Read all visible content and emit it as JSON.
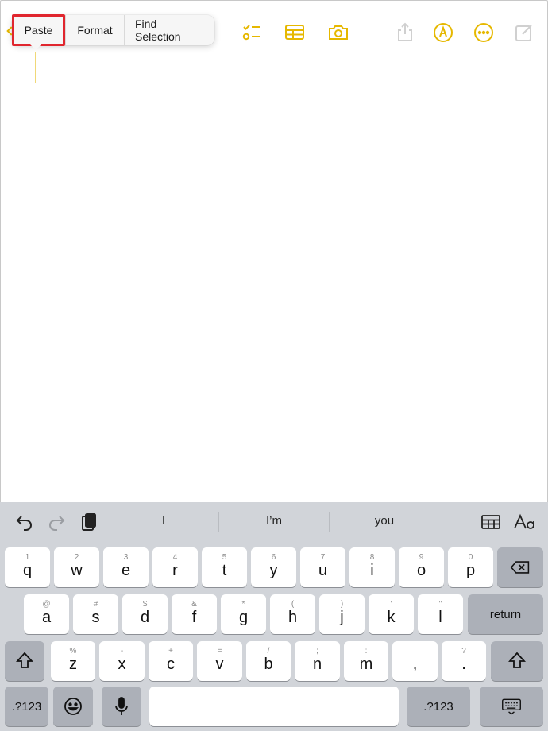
{
  "colors": {
    "accent": "#e6b800",
    "highlight": "#e0262e",
    "keyboard_bg": "#d1d4d9",
    "key": "#ffffff",
    "key_dark": "#acb0b8"
  },
  "toolbar": {
    "icons": [
      "checklist-icon",
      "table-icon",
      "camera-icon",
      "share-icon",
      "markup-pen-icon",
      "more-icon",
      "compose-icon"
    ]
  },
  "context_menu": {
    "items": [
      "Paste",
      "Format",
      "Find Selection"
    ]
  },
  "keyboard": {
    "suggestions": [
      "I",
      "I’m",
      "you"
    ],
    "row1": [
      {
        "alt": "1",
        "key": "q"
      },
      {
        "alt": "2",
        "key": "w"
      },
      {
        "alt": "3",
        "key": "e"
      },
      {
        "alt": "4",
        "key": "r"
      },
      {
        "alt": "5",
        "key": "t"
      },
      {
        "alt": "6",
        "key": "y"
      },
      {
        "alt": "7",
        "key": "u"
      },
      {
        "alt": "8",
        "key": "i"
      },
      {
        "alt": "9",
        "key": "o"
      },
      {
        "alt": "0",
        "key": "p"
      }
    ],
    "row2": [
      {
        "alt": "@",
        "key": "a"
      },
      {
        "alt": "#",
        "key": "s"
      },
      {
        "alt": "$",
        "key": "d"
      },
      {
        "alt": "&",
        "key": "f"
      },
      {
        "alt": "*",
        "key": "g"
      },
      {
        "alt": "(",
        "key": "h"
      },
      {
        "alt": ")",
        "key": "j"
      },
      {
        "alt": "'",
        "key": "k"
      },
      {
        "alt": "\"",
        "key": "l"
      }
    ],
    "row3": [
      {
        "alt": "%",
        "key": "z"
      },
      {
        "alt": "-",
        "key": "x"
      },
      {
        "alt": "+",
        "key": "c"
      },
      {
        "alt": "=",
        "key": "v"
      },
      {
        "alt": "/",
        "key": "b"
      },
      {
        "alt": ";",
        "key": "n"
      },
      {
        "alt": ":",
        "key": "m"
      },
      {
        "alt": "!",
        "key": ","
      },
      {
        "alt": "?",
        "key": "."
      }
    ],
    "return_label": "return",
    "numbers_label": ".?123"
  }
}
